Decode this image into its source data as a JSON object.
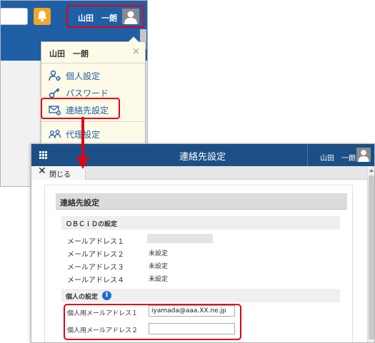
{
  "back": {
    "user_name": "山田　一朗"
  },
  "dropdown": {
    "title": "山田　一朗",
    "close": "×",
    "items": [
      {
        "label": "個人設定",
        "icon": "person-gear-icon"
      },
      {
        "label": "パスワード",
        "icon": "key-icon"
      },
      {
        "label": "連絡先設定",
        "icon": "envelope-gear-icon"
      },
      {
        "label": "代理設定",
        "icon": "proxy-people-icon"
      }
    ]
  },
  "front": {
    "title": "連絡先設定",
    "user_name": "山田　一朗",
    "close_label": "閉じる",
    "section_title": "連絡先設定",
    "obc": {
      "title": "ＯＢＣｉＤの設定",
      "rows": [
        {
          "label": "メールアドレス１",
          "value": ""
        },
        {
          "label": "メールアドレス２",
          "value": "未設定"
        },
        {
          "label": "メールアドレス３",
          "value": "未設定"
        },
        {
          "label": "メールアドレス４",
          "value": "未設定"
        }
      ]
    },
    "personal": {
      "title": "個人の設定",
      "info_glyph": "i",
      "rows": [
        {
          "label": "個人用メールアドレス１",
          "value": "iyamada@aaa.XX.ne.jp",
          "placeholder": ""
        },
        {
          "label": "個人用メールアドレス２",
          "value": "",
          "placeholder": ""
        }
      ]
    }
  },
  "colors": {
    "header_blue": "#1c4f86",
    "link_blue": "#1f5fa6",
    "highlight_red": "#e60012",
    "bell_orange": "#f5a623"
  }
}
